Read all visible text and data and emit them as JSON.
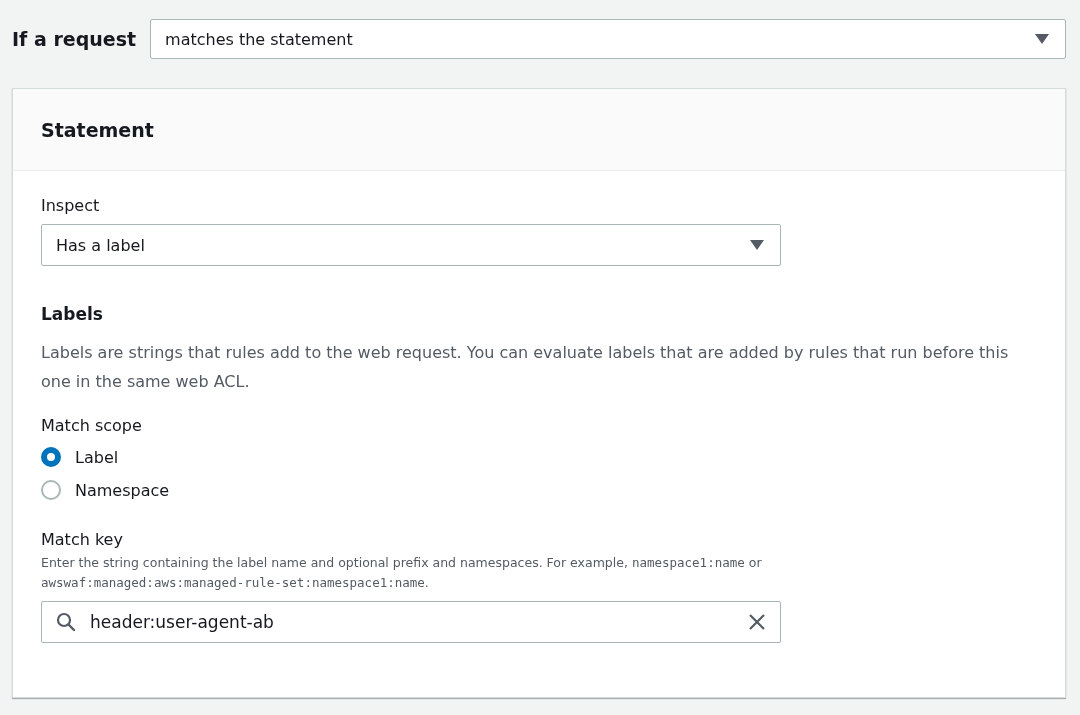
{
  "condition": {
    "label": "If a request",
    "value": "matches the statement"
  },
  "statement": {
    "title": "Statement",
    "inspect": {
      "label": "Inspect",
      "value": "Has a label"
    },
    "labels": {
      "heading": "Labels",
      "description": "Labels are strings that rules add to the web request. You can evaluate labels that are added by rules that run before this one in the same web ACL."
    },
    "match_scope": {
      "label": "Match scope",
      "options": [
        {
          "label": "Label",
          "selected": true
        },
        {
          "label": "Namespace",
          "selected": false
        }
      ]
    },
    "match_key": {
      "label": "Match key",
      "description": [
        {
          "kind": "text",
          "text": "Enter the string containing the label name and optional prefix and namespaces. For example, "
        },
        {
          "kind": "code",
          "text": "namespace1:name"
        },
        {
          "kind": "text",
          "text": " or "
        },
        {
          "kind": "code",
          "text": "awswaf:managed:aws:managed-rule-set:namespace1:name"
        },
        {
          "kind": "text",
          "text": "."
        }
      ],
      "value": "header:user-agent-ab"
    }
  }
}
